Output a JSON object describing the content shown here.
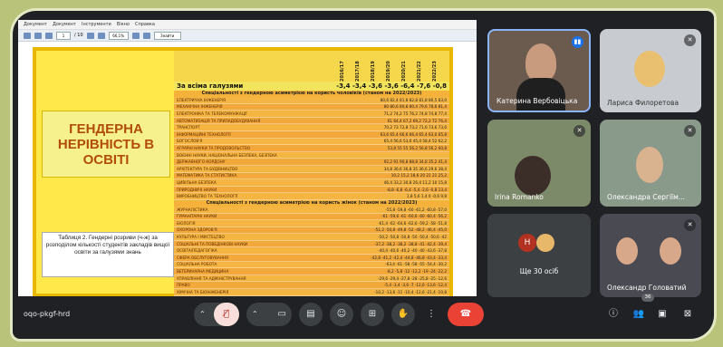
{
  "pdf": {
    "menu": [
      "Документ",
      "Документ",
      "Інструменти",
      "Вікно",
      "Справка"
    ],
    "page_num": "1",
    "page_total": "/ 10",
    "zoom": "66,1%",
    "find": "Знайти"
  },
  "slide": {
    "title": "ГЕНДЕРНА НЕРІВНІСТЬ В ОСВІТІ",
    "caption": "Таблиця 2. Гендерні розриви (ч-ж) за розподілом кількості студентів закладів вищої освіти за галузями знань",
    "years": [
      "2016/17",
      "2017/18",
      "2018/19",
      "2019/20",
      "2020/21",
      "2021/22",
      "2022/23"
    ],
    "all_label": "За всіма галузями",
    "all_values": "-3,4 -3,4 -3,6 -3,6 -6,4 -7,6 -0,8",
    "section1": "Спеціальності з гендерною асиметрією на користь чоловіків (станом на 2022/2023)",
    "section2": "Спеціальності з гендерною асиметрією на користь жінок (станом на 2022/2023)",
    "rows1": [
      {
        "name": "ЕЛЕКТРИЧНА ІНЖЕНЕРІЯ",
        "vals": "80,6 82,4 81,8 82,8 81,8 80,5 83,0"
      },
      {
        "name": "МЕХАНІЧНА ІНЖЕНЕРІЯ",
        "vals": "80 80,6 80,8 80,4 79,6 78,6 81,4"
      },
      {
        "name": "ЕЛЕКТРОНІКА ТА ТЕЛЕКОМУНІКАЦІЇ",
        "vals": "71,2 74,2 75 76,2 74,8 74,8 77,4"
      },
      {
        "name": "АВТОМАТИЗАЦІЯ ТА ПРИЛАДОБУДУВАННЯ",
        "vals": "61 64,4 67,2 69,2 72,2 72 76,4"
      },
      {
        "name": "ТРАНСПОРТ",
        "vals": "70,2 73 72,8 73,2 71,6 73,6 73,6"
      },
      {
        "name": "ІНФОРМАЦІЙНІ ТЕХНОЛОГІЇ",
        "vals": "63,6 65,4 66,6 66,4 65,4 63,0 65,8"
      },
      {
        "name": "БОГОСЛОВ'Я",
        "vals": "65,4 56,6 53,6 45,4 58,4 52 62,2"
      },
      {
        "name": "АГРАРНІ НАУКИ ТА ПРОДОВОЛЬСТВО",
        "vals": "53,8 55 55 56,2 56,8 56,2 60,8"
      },
      {
        "name": "ВОЄННІ НАУКИ, НАЦІОНАЛЬНА БЕЗПЕКА, БЕЗПЕКА",
        "vals": ""
      },
      {
        "name": "ДЕРЖАВНОГО КОРДОНУ",
        "vals": "92,2 91 90,8 88,8 34,8 35,2 41,4"
      },
      {
        "name": "АРХІТЕКТУРА ТА БУДІВНИЦТВО",
        "vals": "34,8 36,6 36,8 35 36,6 29,6 38,4"
      },
      {
        "name": "МАТЕМАТИКА ТА СТАТИСТИКА",
        "vals": "10,2 15,2 18,6 20 21 21 25,2"
      },
      {
        "name": "ЦИВІЛЬНА БЕЗПЕКА",
        "vals": "46,4 33,2 30,8 26,4 11,2 10 15,8"
      },
      {
        "name": "ПРИРОДНИЧІ НАУКИ",
        "vals": "-8,8 -6,8 -6,4 -5,4 -2,6 -0,8 13,4"
      },
      {
        "name": "ВИРОБНИЦТВО ТА ТЕХНОЛОГІЇ",
        "vals": "1,8 5,6 1,4 0 -0,6 9,8"
      }
    ],
    "rows2": [
      {
        "name": "ЖУРНАЛІСТИКА",
        "vals": "-55,8 -59,8 -60 -61,2 -60,8 -57,0"
      },
      {
        "name": "ГУМАНІТАРНІ НАУКИ",
        "vals": "-61 -59,6 -61 -60,6 -60 -60,4 -56,2"
      },
      {
        "name": "БІОЛОГІЯ",
        "vals": "-61,4 -62 -64,6 -62,6 -59,2 -58 -51,8"
      },
      {
        "name": "ОХОРОНА ЗДОРОВ'Я",
        "vals": "-51,2 -50,8 -49,8 -52 -48,2 -46,4 -45,0"
      },
      {
        "name": "КУЛЬТУРА І МИСТЕЦТВО",
        "vals": "-50,2 -50,8 -50,8 -50 -50,4 -50,6 -42"
      },
      {
        "name": "СОЦІАЛЬНІ ТА ПОВЕДІНКОВІ НАУКИ",
        "vals": "-37,2 -38,2 -38,2 -38,8 -41 -42,4 -39,4"
      },
      {
        "name": "ОСВІТА/ПЕДАГОГІКА",
        "vals": "-40,4 -40,6 -40,2 -40 -40 -43,6 -37,8"
      },
      {
        "name": "СФЕРА ОБСЛУГОВУВАННЯ",
        "vals": "-42,8 -41,2 -42,4 -44,8 -46,8 -43,4 -33,4"
      },
      {
        "name": "СОЦІАЛЬНА РОБОТА",
        "vals": "-63,4 -61 -58 -58 -55 -54,4 -30,2"
      },
      {
        "name": "ВЕТЕРИНАРНА МЕДИЦИНА",
        "vals": "-8,2 -5,8 -12 -12,2 -19 -24 -22,2"
      },
      {
        "name": "УПРАВЛІННЯ ТА АДМІНІСТРУВАННЯ",
        "vals": "-29,6 -29,4 -27,8 -28 -25,8 -25 -12,6"
      },
      {
        "name": "ПРАВО",
        "vals": "-5,4 -3,4 -3,6 -7 -12,6 -13,6 -12,4"
      },
      {
        "name": "ХІМІЧНА ТА БІОІНЖЕНЕРІЯ",
        "vals": "-10,2 -13,6 -11 -10,4 -12,6 -21,4 -10,8"
      }
    ]
  },
  "participants": [
    {
      "name": "Катерина Вербовіцька",
      "mic": "speaking"
    },
    {
      "name": "Лариса Филоретова",
      "mic": "muted"
    },
    {
      "name": "Irina Romanko",
      "mic": "muted"
    },
    {
      "name": "Олександра Сергіїм...",
      "mic": "muted"
    },
    {
      "name": "Ще 30 осіб",
      "avatar_letter": "H"
    },
    {
      "name": "Олександр Головатий",
      "mic": "muted"
    }
  ],
  "meeting": {
    "code": "oqo-pkgf-hrd",
    "people_count": "36"
  },
  "colors": {
    "end_call": "#ea4335",
    "mic_muted_bg": "#f9dedc",
    "speaking": "#1a73e8"
  }
}
